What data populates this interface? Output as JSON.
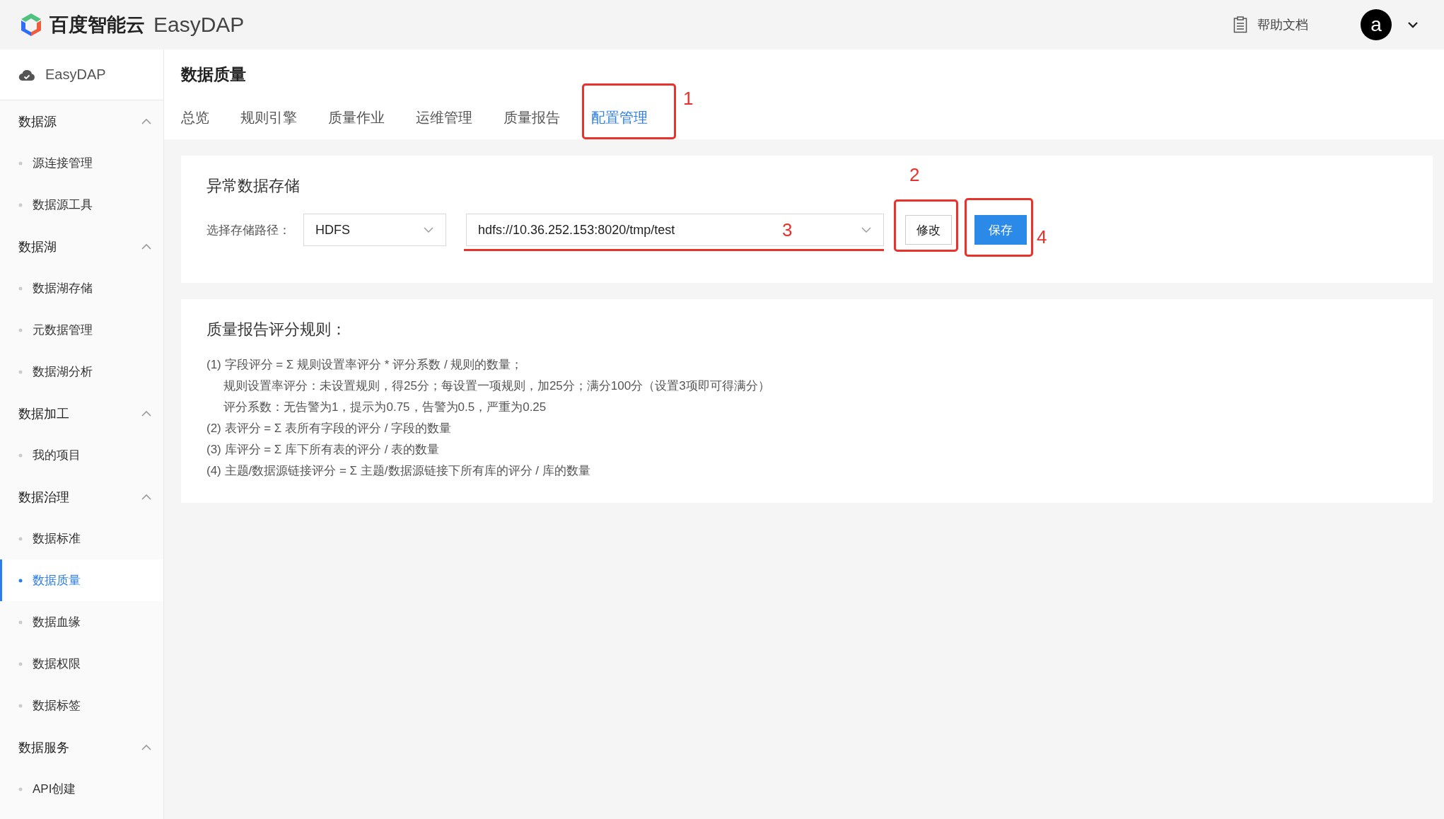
{
  "header": {
    "brand": "百度智能云",
    "product": "EasyDAP",
    "help": "帮助文档",
    "avatar": "a"
  },
  "sidebar": {
    "title": "EasyDAP",
    "groups": [
      {
        "label": "数据源",
        "expanded": true,
        "items": [
          {
            "label": "源连接管理",
            "selected": false
          },
          {
            "label": "数据源工具",
            "selected": false
          }
        ]
      },
      {
        "label": "数据湖",
        "expanded": true,
        "items": [
          {
            "label": "数据湖存储",
            "selected": false
          },
          {
            "label": "元数据管理",
            "selected": false
          },
          {
            "label": "数据湖分析",
            "selected": false
          }
        ]
      },
      {
        "label": "数据加工",
        "expanded": true,
        "items": [
          {
            "label": "我的项目",
            "selected": false
          }
        ]
      },
      {
        "label": "数据治理",
        "expanded": true,
        "items": [
          {
            "label": "数据标准",
            "selected": false
          },
          {
            "label": "数据质量",
            "selected": true
          },
          {
            "label": "数据血缘",
            "selected": false
          },
          {
            "label": "数据权限",
            "selected": false
          },
          {
            "label": "数据标签",
            "selected": false
          }
        ]
      },
      {
        "label": "数据服务",
        "expanded": true,
        "items": [
          {
            "label": "API创建",
            "selected": false
          }
        ]
      }
    ]
  },
  "page": {
    "title": "数据质量",
    "tabs": [
      {
        "label": "总览",
        "selected": false
      },
      {
        "label": "规则引擎",
        "selected": false
      },
      {
        "label": "质量作业",
        "selected": false
      },
      {
        "label": "运维管理",
        "selected": false
      },
      {
        "label": "质量报告",
        "selected": false
      },
      {
        "label": "配置管理",
        "selected": true
      }
    ]
  },
  "storage": {
    "title": "异常数据存储",
    "field_label": "选择存储路径：",
    "type_select": "HDFS",
    "path_select": "hdfs://10.36.252.153:8020/tmp/test",
    "buttons": [
      {
        "label": "修改",
        "kind": "default"
      },
      {
        "label": "保存",
        "kind": "primary"
      }
    ]
  },
  "rules": {
    "title": "质量报告评分规则：",
    "items": [
      {
        "text": "(1) 字段评分 = Σ 规则设置率评分 * 评分系数 / 规则的数量；",
        "children": [
          {
            "text": "规则设置率评分：未设置规则，得25分；每设置一项规则，加25分；满分100分（设置3项即可得满分）"
          },
          {
            "text": "评分系数：无告警为1，提示为0.75，告警为0.5，严重为0.25"
          }
        ]
      },
      {
        "text": "(2) 表评分 = Σ 表所有字段的评分 / 字段的数量"
      },
      {
        "text": "(3) 库评分 = Σ 库下所有表的评分 / 表的数量"
      },
      {
        "text": "(4) 主题/数据源链接评分 = Σ 主题/数据源链接下所有库的评分 / 库的数量"
      }
    ]
  },
  "annotations": [
    {
      "label": "1",
      "kind": "box"
    },
    {
      "label": "2",
      "kind": "box"
    },
    {
      "label": "3",
      "kind": "underline"
    },
    {
      "label": "4",
      "kind": "box"
    }
  ]
}
